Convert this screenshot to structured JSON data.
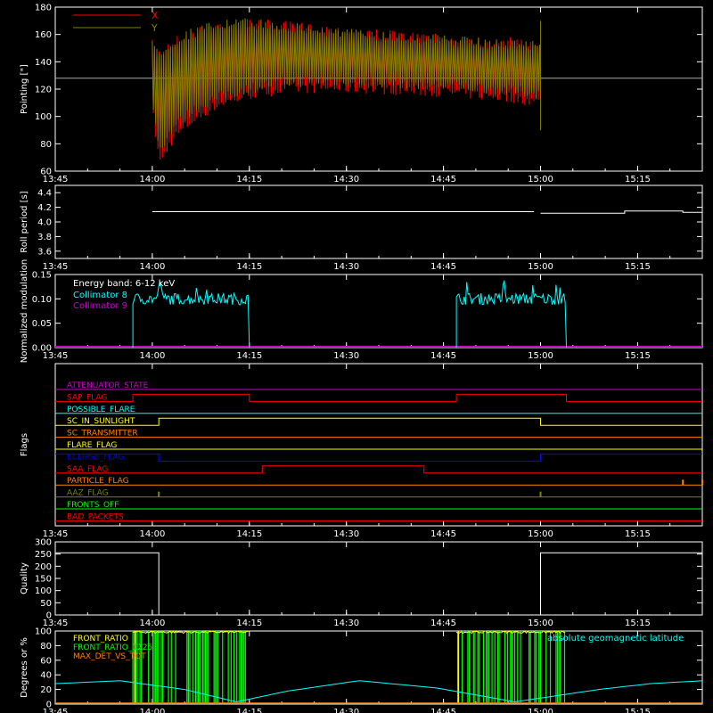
{
  "colors": {
    "background": "#000000",
    "axes": "#ffffff",
    "red": "#ff0000",
    "olive": "#808000",
    "cyan": "#00ffff",
    "magenta": "#cc00cc",
    "green": "#00ff00",
    "yellow": "#ffff00",
    "orange": "#ff8000",
    "blue": "#0000ff"
  },
  "time_ticks": [
    "13:45",
    "14:00",
    "14:15",
    "14:30",
    "14:45",
    "15:00",
    "15:15"
  ],
  "chart_data": [
    {
      "id": "pointing",
      "type": "line",
      "ylabel": "Pointing [\"]",
      "ylim": [
        60,
        180
      ],
      "yticks": [
        60,
        80,
        100,
        120,
        140,
        160,
        180
      ],
      "xlim": [
        "13:45",
        "15:25"
      ],
      "legend": {
        "position": "top-left",
        "entries": [
          {
            "name": "X",
            "color": "#ff0000"
          },
          {
            "name": "Y",
            "color": "#808000"
          }
        ]
      },
      "reference_line": 128,
      "series": [
        {
          "name": "X",
          "x": [
            "14:00",
            "14:01",
            "14:03",
            "14:06",
            "14:10",
            "14:15",
            "14:20",
            "14:25",
            "14:30",
            "14:35",
            "14:40",
            "14:45",
            "14:50",
            "14:55",
            "15:00"
          ],
          "upper": [
            156,
            150,
            158,
            164,
            170,
            172,
            170,
            168,
            166,
            164,
            162,
            160,
            159,
            158,
            157
          ],
          "lower": [
            95,
            62,
            80,
            93,
            105,
            112,
            116,
            117,
            117,
            116,
            115,
            114,
            112,
            110,
            106
          ]
        },
        {
          "name": "Y",
          "x": [
            "14:00",
            "14:01",
            "14:03",
            "14:06",
            "14:10",
            "14:15",
            "14:20",
            "14:25",
            "14:30",
            "14:35",
            "14:40",
            "14:45",
            "14:50",
            "14:55",
            "15:00"
          ],
          "upper": [
            155,
            150,
            158,
            165,
            171,
            172,
            170,
            167,
            165,
            163,
            161,
            160,
            158,
            157,
            156
          ],
          "lower": [
            100,
            72,
            88,
            100,
            110,
            117,
            121,
            122,
            122,
            121,
            120,
            119,
            117,
            115,
            112
          ]
        }
      ]
    },
    {
      "id": "roll",
      "type": "line",
      "ylabel": "Roll period [s]",
      "ylim": [
        3.5,
        4.5
      ],
      "yticks": [
        3.6,
        3.8,
        4.0,
        4.2,
        4.4
      ],
      "xlim": [
        "13:45",
        "15:25"
      ],
      "series": [
        {
          "name": "",
          "x": [
            "14:00",
            "15:00",
            "15:13",
            "15:25"
          ],
          "y": [
            4.14,
            4.12,
            4.15,
            4.13
          ]
        }
      ]
    },
    {
      "id": "modulation",
      "type": "line",
      "ylabel": "Normalized modulation",
      "ylim": [
        0,
        0.15
      ],
      "yticks": [
        0.0,
        0.05,
        0.1,
        0.15
      ],
      "xlim": [
        "13:45",
        "15:25"
      ],
      "annotation": "Energy band: 6-12 keV",
      "legend": {
        "position": "top-left",
        "entries": [
          {
            "name": "Collimator 8",
            "color": "#00ffff"
          },
          {
            "name": "Collimator 9",
            "color": "#cc00cc"
          }
        ]
      },
      "series": [
        {
          "name": "Collimator 8",
          "segments": [
            {
              "start": "13:57",
              "end": "14:15",
              "mean": 0.1,
              "spread": 0.012
            },
            {
              "start": "14:47",
              "end": "15:04",
              "mean": 0.1,
              "spread": 0.012
            }
          ]
        },
        {
          "name": "Collimator 9",
          "y_constant": 0.0
        }
      ]
    },
    {
      "id": "flags",
      "type": "line",
      "ylabel": "Flags",
      "xlim": [
        "13:45",
        "15:25"
      ],
      "flags": [
        {
          "name": "ATTENUATOR_STATE",
          "color": "#cc00cc",
          "transitions": []
        },
        {
          "name": "SAP_FLAG",
          "color": "#ff0000",
          "transitions": [
            "13:57",
            "14:15",
            "14:47",
            "15:04"
          ],
          "initial": 0
        },
        {
          "name": "POSSIBLE_FLARE",
          "color": "#00ffff",
          "transitions": []
        },
        {
          "name": "SC_IN_SUNLIGHT",
          "color": "#ffff00",
          "transitions": [
            "14:01",
            "15:00"
          ],
          "initial": 0
        },
        {
          "name": "SC_TRANSMITTER",
          "color": "#ff8000",
          "transitions": []
        },
        {
          "name": "FLARE_FLAG",
          "color": "#ffff00",
          "transitions": []
        },
        {
          "name": "ECLIPSE_FLAG",
          "color": "#0000ff",
          "transitions": [
            "14:01",
            "15:00"
          ],
          "initial": 1
        },
        {
          "name": "SAA_FLAG",
          "color": "#ff0000",
          "transitions": [
            "14:17",
            "14:42"
          ],
          "initial": 0
        },
        {
          "name": "PARTICLE_FLAG",
          "color": "#ff8000",
          "transitions": [],
          "spikes": [
            "15:22",
            "15:25"
          ]
        },
        {
          "name": "AAZ_FLAG",
          "color": "#808000",
          "transitions": [],
          "spikes": [
            "14:01",
            "15:00"
          ]
        },
        {
          "name": "FRONTS_OFF",
          "color": "#00ff00",
          "transitions": []
        },
        {
          "name": "BAD_PACKETS",
          "color": "#ff0000",
          "transitions": []
        }
      ]
    },
    {
      "id": "quality",
      "type": "line",
      "ylabel": "Quality",
      "ylim": [
        0,
        300
      ],
      "yticks": [
        0,
        50,
        100,
        150,
        200,
        250,
        300
      ],
      "xlim": [
        "13:45",
        "15:25"
      ],
      "series": [
        {
          "name": "",
          "x": [
            "13:45",
            "14:01",
            "14:01",
            "15:00",
            "15:00",
            "15:25"
          ],
          "y": [
            255,
            255,
            0,
            0,
            255,
            255
          ]
        }
      ]
    },
    {
      "id": "ratios",
      "type": "line",
      "ylabel": "Degrees or %",
      "ylim": [
        0,
        100
      ],
      "yticks": [
        0,
        20,
        40,
        60,
        80,
        100
      ],
      "xlim": [
        "13:45",
        "15:25"
      ],
      "legend": {
        "position": "top-left",
        "entries": [
          {
            "name": "FRONT_RATIO",
            "color": "#ffff00"
          },
          {
            "name": "FRONT_RATIO_1225",
            "color": "#00ff00"
          },
          {
            "name": "MAX_DET_VS_TOT",
            "color": "#ff8000"
          }
        ]
      },
      "annotation": "absolute geomagnetic latitude",
      "series": [
        {
          "name": "absolute geomagnetic latitude",
          "x": [
            "13:45",
            "13:55",
            "14:05",
            "14:13",
            "14:21",
            "14:32",
            "14:44",
            "14:56",
            "15:09",
            "15:17",
            "15:25"
          ],
          "y": [
            28,
            32,
            20,
            3,
            18,
            32,
            22,
            3,
            20,
            28,
            32
          ]
        },
        {
          "name": "FRONT_RATIO_1225",
          "segments": [
            {
              "start": "13:57",
              "end": "14:15"
            },
            {
              "start": "14:47",
              "end": "15:04"
            }
          ]
        }
      ]
    }
  ]
}
